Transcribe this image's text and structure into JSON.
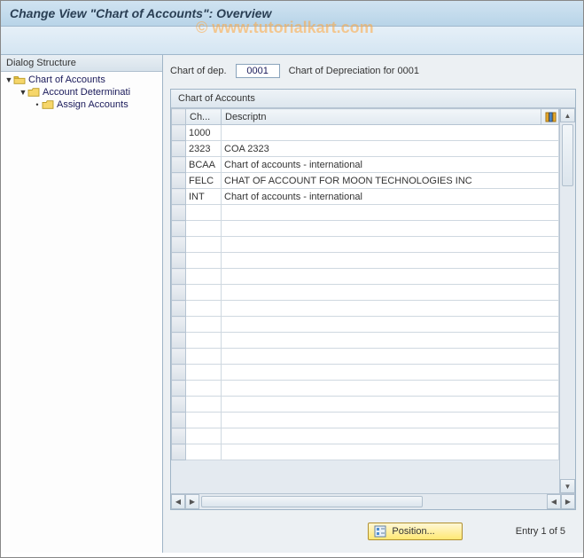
{
  "header": {
    "title": "Change View \"Chart of Accounts\": Overview"
  },
  "watermark": "© www.tutorialkart.com",
  "sidebar": {
    "header": "Dialog Structure",
    "items": [
      {
        "label": "Chart of Accounts",
        "open": true
      },
      {
        "label": "Account Determinati",
        "open": true
      },
      {
        "label": "Assign Accounts",
        "open": false
      }
    ]
  },
  "fields": {
    "chart_of_dep": {
      "label": "Chart of dep.",
      "value": "0001",
      "description": "Chart of Depreciation for 0001"
    }
  },
  "table": {
    "title": "Chart of Accounts",
    "columns": [
      "Ch...",
      "Descriptn"
    ],
    "rows": [
      {
        "code": "1000",
        "desc": ""
      },
      {
        "code": "2323",
        "desc": "COA 2323"
      },
      {
        "code": "BCAA",
        "desc": "Chart of accounts - international"
      },
      {
        "code": "FELC",
        "desc": "CHAT OF ACCOUNT FOR MOON TECHNOLOGIES INC"
      },
      {
        "code": "INT",
        "desc": "Chart of accounts - international"
      }
    ],
    "empty_rows": 16
  },
  "footer": {
    "position_label": "Position...",
    "entry_status": "Entry 1 of 5"
  }
}
